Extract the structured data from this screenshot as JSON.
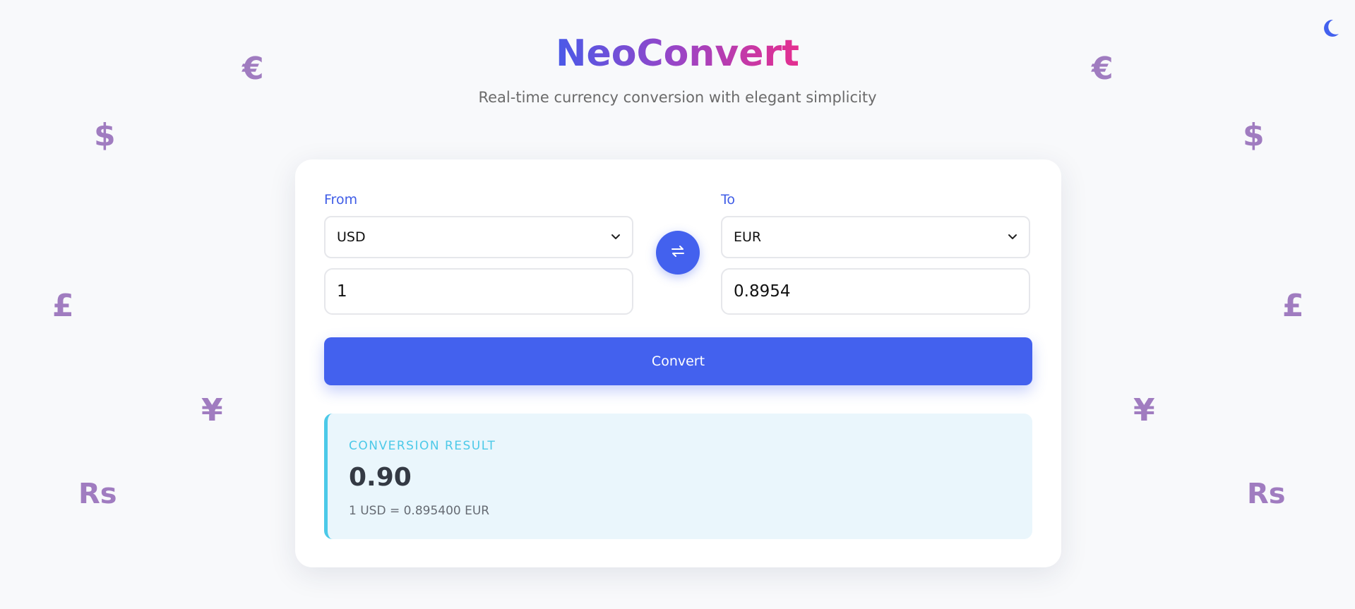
{
  "header": {
    "title": "NeoConvert",
    "subtitle": "Real-time currency conversion with elegant simplicity"
  },
  "theme_toggle": {
    "icon": "moon-icon",
    "color": "#4361ee"
  },
  "decorations": {
    "symbols": [
      "€",
      "$",
      "£",
      "¥",
      "Rs",
      "€",
      "$",
      "£",
      "¥",
      "Rs"
    ]
  },
  "converter": {
    "from_label": "From",
    "from_currency": "USD",
    "from_amount": "1",
    "to_label": "To",
    "to_currency": "EUR",
    "to_amount": "0.8954",
    "swap_icon": "swap-arrows-icon",
    "convert_label": "Convert"
  },
  "result": {
    "label": "Conversion Result",
    "value": "0.90",
    "rate": "1 USD = 0.895400 EUR"
  },
  "colors": {
    "accent": "#4361ee",
    "result_accent": "#4cc9e8",
    "decoration": "#a07cc0"
  }
}
